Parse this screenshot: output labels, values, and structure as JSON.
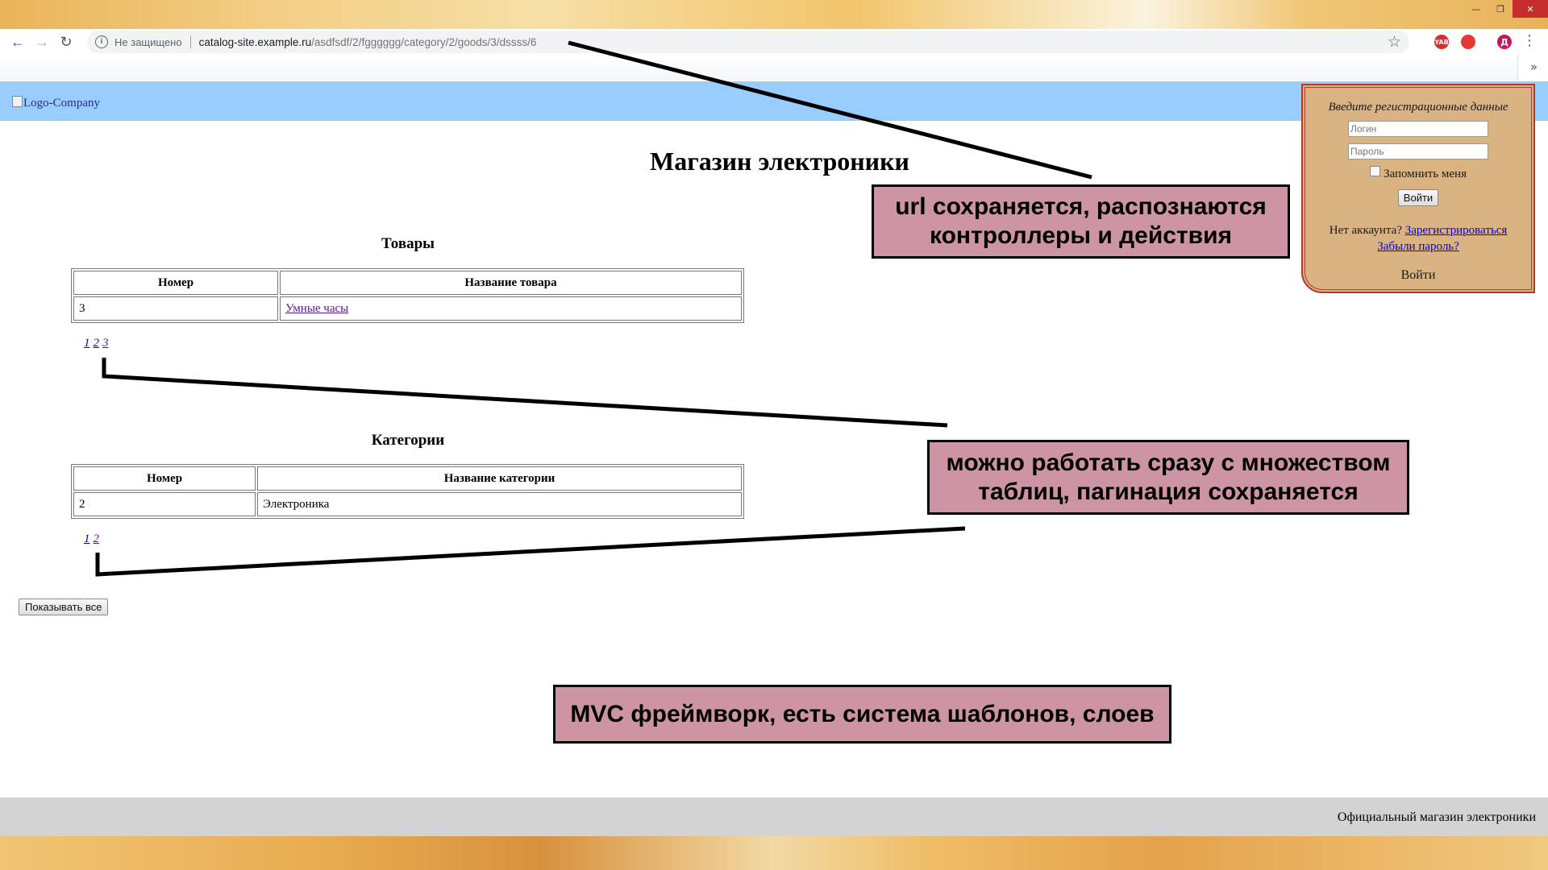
{
  "browser": {
    "security_label": "Не защищено",
    "url_host": "catalog-site.example.ru",
    "url_path": "/asdfsdf/2/fgggggg/category/2/goods/3/dssss/6",
    "ext1": "YAB",
    "ext2": "",
    "profile_letter": "Д",
    "bookmarks_more": "»"
  },
  "header": {
    "logo_alt": "Logo-Company"
  },
  "login": {
    "title": "Введите регистрационные данные",
    "login_placeholder": "Логин",
    "password_placeholder": "Пароль",
    "remember_label": "Запомнить меня",
    "submit_label": "Войти",
    "no_account": "Нет аккаунта?",
    "register_link": "Зарегистрироваться",
    "forgot_link": "Забыли пароль?",
    "footer_label": "Войти"
  },
  "page": {
    "title": "Магазин электроники"
  },
  "goods": {
    "title": "Товары",
    "columns": [
      "Номер",
      "Название товара"
    ],
    "rows": [
      {
        "id": "3",
        "name": "Умные часы"
      }
    ],
    "pages": [
      "1",
      "2",
      "3"
    ]
  },
  "categories": {
    "title": "Категории",
    "columns": [
      "Номер",
      "Название категории"
    ],
    "rows": [
      {
        "id": "2",
        "name": "Электроника"
      }
    ],
    "pages": [
      "1",
      "2"
    ]
  },
  "show_all_label": "Показывать все",
  "footer": {
    "text": "Официальный магазин электроники"
  },
  "annotations": {
    "url_note": "url сохраняется, распознаются контроллеры и действия",
    "pagination_note": "можно работать сразу с множеством таблиц, пагинация сохраняется",
    "mvc_note": "MVC фреймворк, есть система шаблонов, слоев"
  },
  "colors": {
    "header_bg": "#99ccff",
    "login_bg": "#dab383",
    "login_border": "#b03a2e",
    "callout_bg": "#cd94a3",
    "footer_bg": "#d3d3d3"
  }
}
